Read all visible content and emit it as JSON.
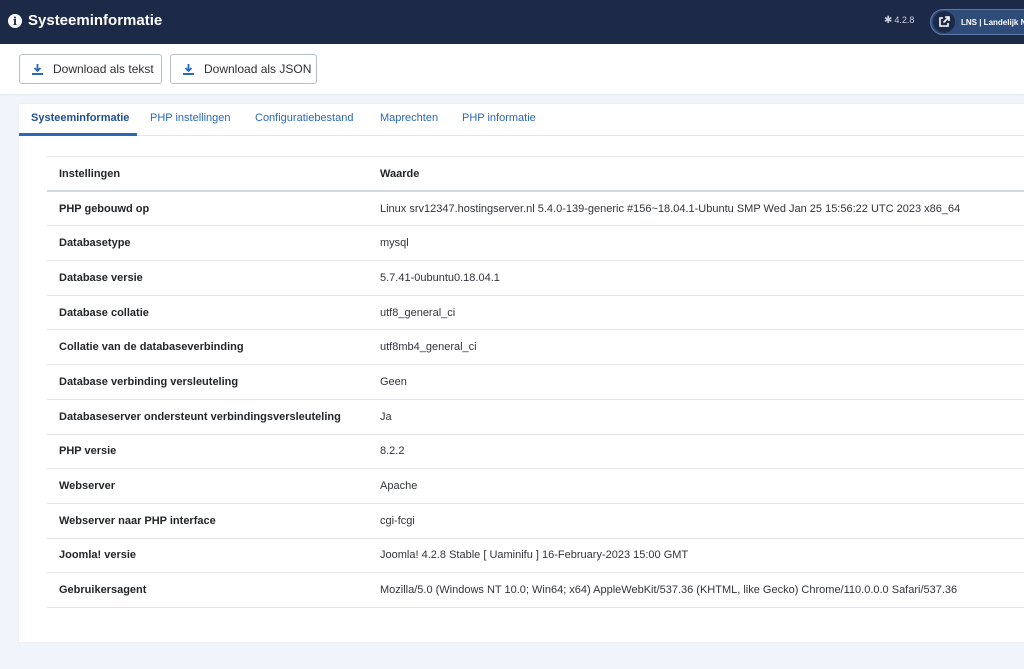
{
  "header": {
    "title": "Systeeminformatie",
    "title_icon": "info-icon",
    "version": "4.2.8",
    "version_icon": "joomla-icon",
    "site_label": "LNS | Landelijk Ne",
    "site_icon": "external-link-icon",
    "bar_color": "#1c2a47"
  },
  "toolbar": {
    "download_text_label": "Download als tekst",
    "download_json_label": "Download als JSON",
    "download_icon": "download-icon"
  },
  "tabs": [
    {
      "label": "Systeeminformatie",
      "active": true
    },
    {
      "label": "PHP instellingen",
      "active": false
    },
    {
      "label": "Configuratiebestand",
      "active": false
    },
    {
      "label": "Maprechten",
      "active": false
    },
    {
      "label": "PHP informatie",
      "active": false
    }
  ],
  "table": {
    "columns": [
      "Instellingen",
      "Waarde"
    ],
    "rows": [
      {
        "key": "PHP gebouwd op",
        "value": "Linux srv12347.hostingserver.nl 5.4.0-139-generic #156~18.04.1-Ubuntu SMP Wed Jan 25 15:56:22 UTC 2023 x86_64"
      },
      {
        "key": "Databasetype",
        "value": "mysql"
      },
      {
        "key": "Database versie",
        "value": "5.7.41-0ubuntu0.18.04.1"
      },
      {
        "key": "Database collatie",
        "value": "utf8_general_ci"
      },
      {
        "key": "Collatie van de databaseverbinding",
        "value": "utf8mb4_general_ci"
      },
      {
        "key": "Database verbinding versleuteling",
        "value": "Geen"
      },
      {
        "key": "Databaseserver ondersteunt verbindingsversleuteling",
        "value": "Ja"
      },
      {
        "key": "PHP versie",
        "value": "8.2.2"
      },
      {
        "key": "Webserver",
        "value": "Apache"
      },
      {
        "key": "Webserver naar PHP interface",
        "value": "cgi-fcgi"
      },
      {
        "key": "Joomla! versie",
        "value": "Joomla! 4.2.8 Stable [ Uaminifu ] 16-February-2023 15:00 GMT"
      },
      {
        "key": "Gebruikersagent",
        "value": "Mozilla/5.0 (Windows NT 10.0; Win64; x64) AppleWebKit/537.36 (KHTML, like Gecko) Chrome/110.0.0.0 Safari/537.36"
      }
    ]
  }
}
